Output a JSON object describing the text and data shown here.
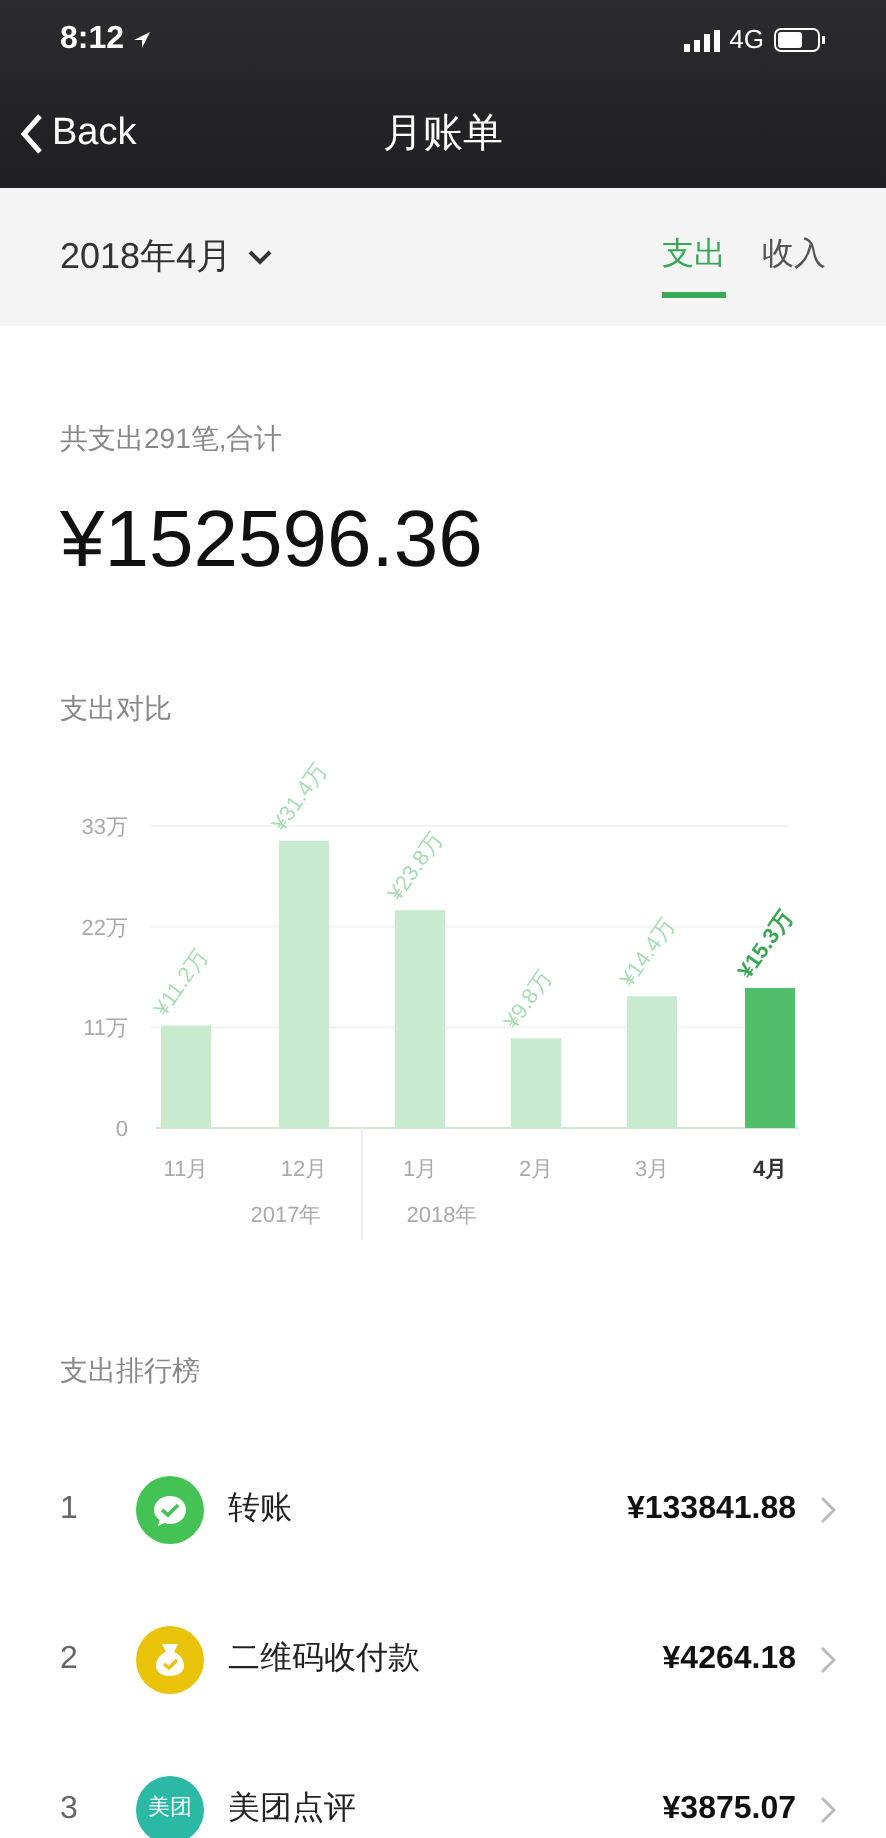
{
  "status_bar": {
    "time": "8:12",
    "network": "4G"
  },
  "nav": {
    "back": "Back",
    "title": "月账单"
  },
  "filter": {
    "month": "2018年4月",
    "tabs": [
      {
        "label": "支出",
        "selected": true
      },
      {
        "label": "收入",
        "selected": false
      }
    ]
  },
  "summary": {
    "caption": "共支出291笔,合计",
    "total": "¥152596.36"
  },
  "comparison": {
    "title": "支出对比",
    "chart_data": {
      "type": "bar",
      "categories": [
        "11月",
        "12月",
        "1月",
        "2月",
        "3月",
        "4月"
      ],
      "values": [
        11.2,
        31.4,
        23.8,
        9.8,
        14.4,
        15.3
      ],
      "ylim": [
        0,
        33
      ],
      "yticks": [
        {
          "value": 0,
          "label": "0"
        },
        {
          "value": 11,
          "label": "11万"
        },
        {
          "value": 22,
          "label": "22万"
        },
        {
          "value": 33,
          "label": "33万"
        }
      ],
      "value_labels": [
        "¥11.2万",
        "¥31.4万",
        "¥23.8万",
        "¥9.8万",
        "¥14.4万",
        "¥15.3万"
      ]
    },
    "bars": [
      {
        "selected": false
      },
      {
        "selected": false
      },
      {
        "selected": false
      },
      {
        "selected": false
      },
      {
        "selected": false
      },
      {
        "selected": true
      }
    ],
    "years": [
      {
        "label": "2017年"
      },
      {
        "label": "2018年"
      }
    ]
  },
  "ranking": {
    "title": "支出排行榜",
    "items": [
      {
        "rank": "1",
        "kind": "chat",
        "color": "#44c256",
        "name": "转账",
        "amount": "¥133841.88"
      },
      {
        "rank": "2",
        "kind": "bag",
        "color": "#e9c30a",
        "name": "二维码收付款",
        "amount": "¥4264.18"
      },
      {
        "rank": "3",
        "kind": "text",
        "color": "#2bb8a5",
        "icon_text": "美团",
        "name": "美团点评",
        "amount": "¥3875.07"
      }
    ]
  }
}
